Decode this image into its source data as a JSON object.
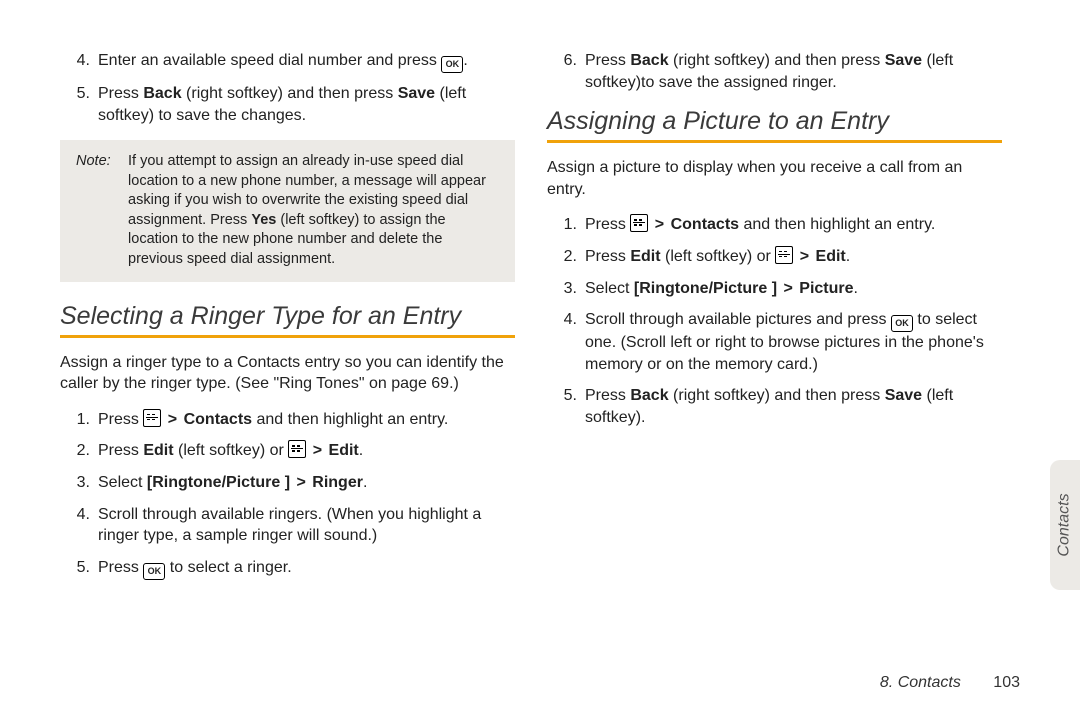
{
  "col1": {
    "pre_items": [
      {
        "num": "4.",
        "parts": [
          "Enter an available speed dial number and press ",
          {
            "icon": "ok"
          },
          "."
        ]
      },
      {
        "num": "5.",
        "parts": [
          "Press ",
          {
            "b": "Back"
          },
          " (right softkey) and then press ",
          {
            "b": "Save"
          },
          " (left softkey) to save the changes."
        ]
      }
    ],
    "note": {
      "label": "Note:",
      "body_parts": [
        "If you attempt to assign an already in-use speed dial location to a new phone number, a message will appear asking if you wish to overwrite the existing speed dial assignment. Press ",
        {
          "b": "Yes"
        },
        " (left softkey) to assign the location to the new phone number and delete the previous speed dial assignment."
      ]
    },
    "h2": "Selecting a Ringer Type for an Entry",
    "intro": "Assign a ringer type to a Contacts entry so you can identify the caller by the ringer type. (See \"Ring Tones\" on page 69.)",
    "items": [
      {
        "num": "1.",
        "parts": [
          "Press ",
          {
            "icon": "menu"
          },
          " ",
          {
            "gt": ">"
          },
          " ",
          {
            "b": "Contacts"
          },
          " and then highlight an entry."
        ]
      },
      {
        "num": "2.",
        "parts": [
          "Press ",
          {
            "b": "Edit"
          },
          " (left softkey) or ",
          {
            "icon": "menu"
          },
          " ",
          {
            "gt": ">"
          },
          " ",
          {
            "b": "Edit"
          },
          "."
        ]
      },
      {
        "num": "3.",
        "parts": [
          "Select ",
          {
            "b": "[Ringtone/Picture ]"
          },
          " ",
          {
            "gt": ">"
          },
          " ",
          {
            "b": "Ringer"
          },
          "."
        ]
      },
      {
        "num": "4.",
        "parts": [
          "Scroll through available ringers. (When you highlight a ringer type, a sample ringer will sound.)"
        ]
      },
      {
        "num": "5.",
        "parts": [
          "Press ",
          {
            "icon": "ok"
          },
          " to select a ringer."
        ]
      }
    ]
  },
  "col2": {
    "pre_items": [
      {
        "num": "6.",
        "parts": [
          "Press ",
          {
            "b": "Back"
          },
          " (right softkey) and then press ",
          {
            "b": "Save"
          },
          " (left softkey)to save the assigned ringer."
        ]
      }
    ],
    "h2": "Assigning a Picture to an Entry",
    "intro": "Assign a picture to display when you receive a call from an entry.",
    "items": [
      {
        "num": "1.",
        "parts": [
          "Press ",
          {
            "icon": "menu"
          },
          " ",
          {
            "gt": ">"
          },
          " ",
          {
            "b": "Contacts"
          },
          " and then highlight an entry."
        ]
      },
      {
        "num": "2.",
        "parts": [
          "Press ",
          {
            "b": "Edit"
          },
          " (left softkey) or ",
          {
            "icon": "menu"
          },
          " ",
          {
            "gt": ">"
          },
          " ",
          {
            "b": "Edit"
          },
          "."
        ]
      },
      {
        "num": "3.",
        "parts": [
          "Select ",
          {
            "b": "[Ringtone/Picture ]"
          },
          " ",
          {
            "gt": ">"
          },
          " ",
          {
            "b": "Picture"
          },
          "."
        ]
      },
      {
        "num": "4.",
        "parts": [
          "Scroll through available pictures and press ",
          {
            "icon": "ok"
          },
          " to select one. (Scroll left or right  to browse pictures in the phone's memory or on the memory card.)"
        ]
      },
      {
        "num": "5.",
        "parts": [
          "Press ",
          {
            "b": "Back"
          },
          " (right softkey) and then press ",
          {
            "b": "Save"
          },
          " (left softkey)."
        ]
      }
    ]
  },
  "side_tab": "Contacts",
  "footer": {
    "chapter": "8. Contacts",
    "page": "103"
  },
  "icons": {
    "ok": "OK"
  }
}
